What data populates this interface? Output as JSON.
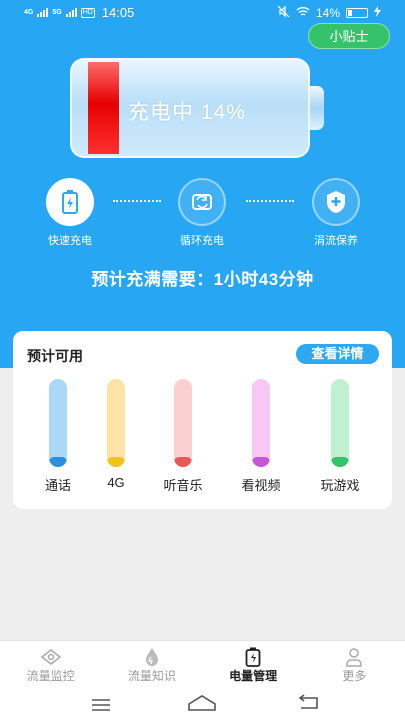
{
  "status_bar": {
    "network_left": "4G",
    "network_right": "5G",
    "hd": "HD",
    "time": "14:05",
    "battery_percent": "14%"
  },
  "tip_button": "小贴士",
  "battery": {
    "status_text": "充电中 14%",
    "level_fraction": 0.14,
    "fill_color": "#e60000"
  },
  "modes": [
    {
      "label": "快速充电",
      "icon": "battery-bolt-icon",
      "active": true
    },
    {
      "label": "循环充电",
      "icon": "cycle-arrows-icon",
      "active": false
    },
    {
      "label": "涓流保养",
      "icon": "shield-plus-icon",
      "active": false
    }
  ],
  "estimate_text": "预计充满需要：1小时43分钟",
  "usage_card": {
    "title": "预计可用",
    "detail_button": "查看详情",
    "items": [
      {
        "label": "通话",
        "tube_color": "#a9d8f8",
        "level_color": "#2a8fe0"
      },
      {
        "label": "4G",
        "tube_color": "#fde3a6",
        "level_color": "#f0c419"
      },
      {
        "label": "听音乐",
        "tube_color": "#fbd0d0",
        "level_color": "#e65a5a"
      },
      {
        "label": "看视频",
        "tube_color": "#f6c8f3",
        "level_color": "#c456d8"
      },
      {
        "label": "玩游戏",
        "tube_color": "#bff0cf",
        "level_color": "#35c26b"
      }
    ]
  },
  "bottom_nav": [
    {
      "label": "流量监控",
      "icon": "eye-icon",
      "active": false
    },
    {
      "label": "流量知识",
      "icon": "water-drop-icon",
      "active": false
    },
    {
      "label": "电量管理",
      "icon": "battery-charge-icon",
      "active": true
    },
    {
      "label": "更多",
      "icon": "person-icon",
      "active": false
    }
  ],
  "system_nav": [
    "menu-icon",
    "home-icon",
    "back-icon"
  ]
}
